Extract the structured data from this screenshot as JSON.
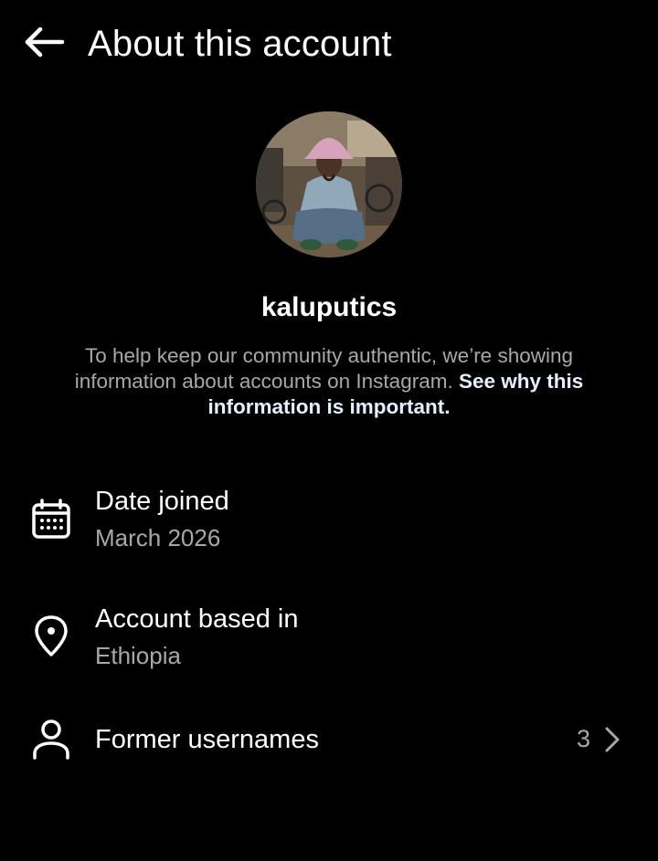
{
  "header": {
    "title": "About this account",
    "back_icon": "arrow-left-icon"
  },
  "profile": {
    "username": "kaluputics",
    "avatar_icon": "profile-photo"
  },
  "info": {
    "text": "To help keep our community authentic, we’re showing information about accounts on Instagram.",
    "link": "See why this information is important."
  },
  "details": {
    "date_joined": {
      "icon": "calendar-icon",
      "title": "Date joined",
      "value": "March 2026"
    },
    "based_in": {
      "icon": "location-pin-icon",
      "title": "Account based in",
      "value": "Ethiopia"
    },
    "former_usernames": {
      "icon": "person-icon",
      "title": "Former usernames",
      "count": "3",
      "chevron": "chevron-right-icon"
    }
  },
  "colors": {
    "background": "#000000",
    "text_primary": "#ffffff",
    "text_secondary": "#a8a8a8",
    "link": "#e6f0ff"
  }
}
